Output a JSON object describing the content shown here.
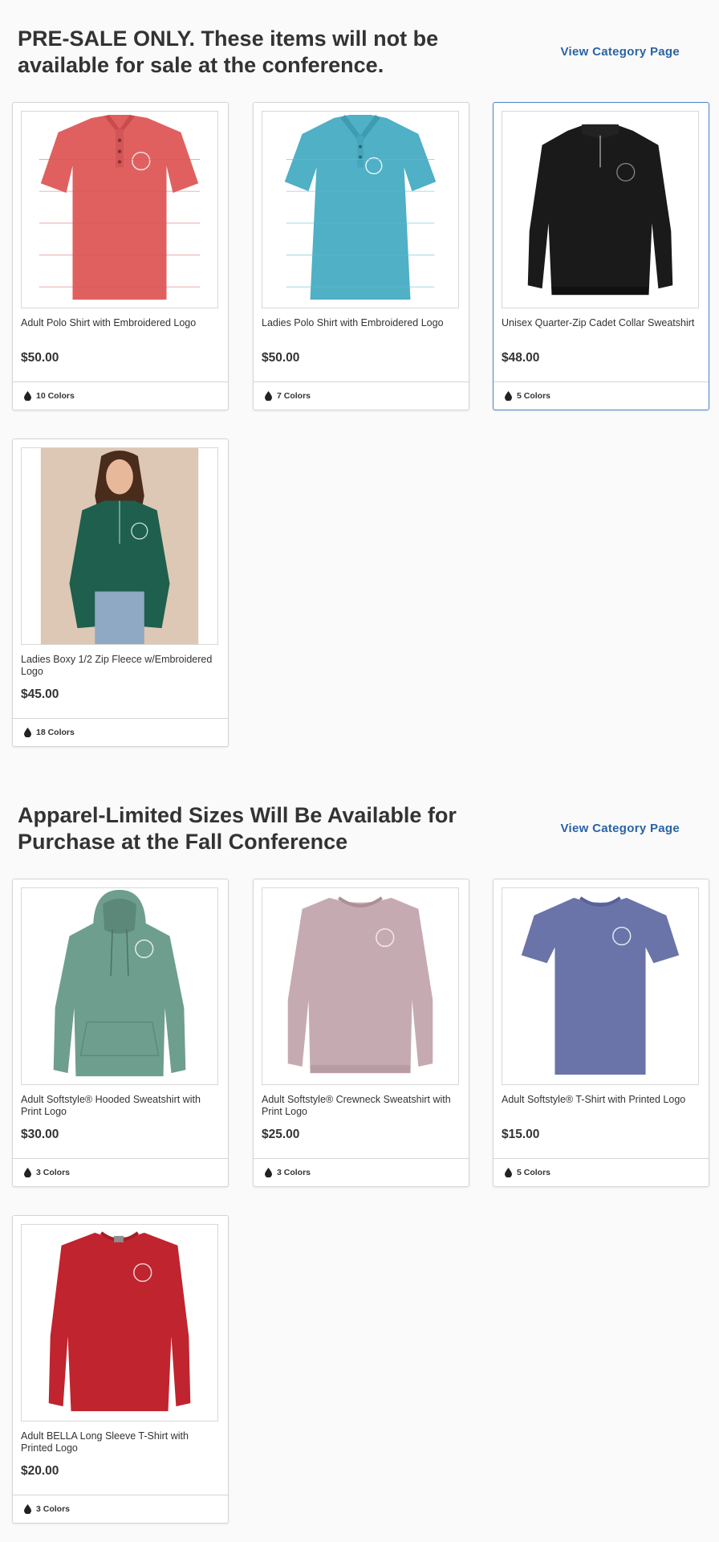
{
  "sections": [
    {
      "title": "PRE-SALE ONLY. These items will not be available for sale at the conference.",
      "link": "View Category Page",
      "products": [
        {
          "name": "Adult Polo Shirt with Embroidered Logo",
          "price": "$50.00",
          "colors": "10 Colors",
          "image_color": "#e06060",
          "image": "polo-shirt-red"
        },
        {
          "name": "Ladies Polo Shirt with Embroidered Logo",
          "price": "$50.00",
          "colors": "7 Colors",
          "image_color": "#4fb0c6",
          "image": "polo-shirt-teal"
        },
        {
          "name": "Unisex Quarter-Zip Cadet Collar Sweatshirt",
          "price": "$48.00",
          "colors": "5 Colors",
          "image_color": "#1a1a1a",
          "image": "quarter-zip-sweatshirt-black"
        },
        {
          "name": "Ladies Boxy 1/2 Zip Fleece w/Embroidered Logo",
          "price": "$45.00",
          "colors": "18 Colors",
          "image_color": "#1e5f4e",
          "image": "half-zip-fleece-green-model"
        }
      ]
    },
    {
      "title": "Apparel-Limited Sizes Will Be Available for Purchase at the Fall Conference",
      "link": "View Category Page",
      "products": [
        {
          "name": "Adult Softstyle® Hooded Sweatshirt with Print Logo",
          "price": "$30.00",
          "colors": "3 Colors",
          "image_color": "#6e9e8e",
          "image": "hooded-sweatshirt-sage"
        },
        {
          "name": "Adult Softstyle® Crewneck Sweatshirt with Print Logo",
          "price": "$25.00",
          "colors": "3 Colors",
          "image_color": "#c6aab2",
          "image": "crewneck-sweatshirt-mauve"
        },
        {
          "name": "Adult Softstyle® T-Shirt with Printed Logo",
          "price": "$15.00",
          "colors": "5 Colors",
          "image_color": "#6a74a8",
          "image": "t-shirt-heather-blue"
        },
        {
          "name": "Adult BELLA Long Sleeve T-Shirt with Printed Logo",
          "price": "$20.00",
          "colors": "3 Colors",
          "image_color": "#c0242e",
          "image": "long-sleeve-t-shirt-red"
        }
      ]
    }
  ],
  "colors": {
    "link": "#2a63a6",
    "active_border": "#4a86c8",
    "page_background": "#fafafa"
  }
}
